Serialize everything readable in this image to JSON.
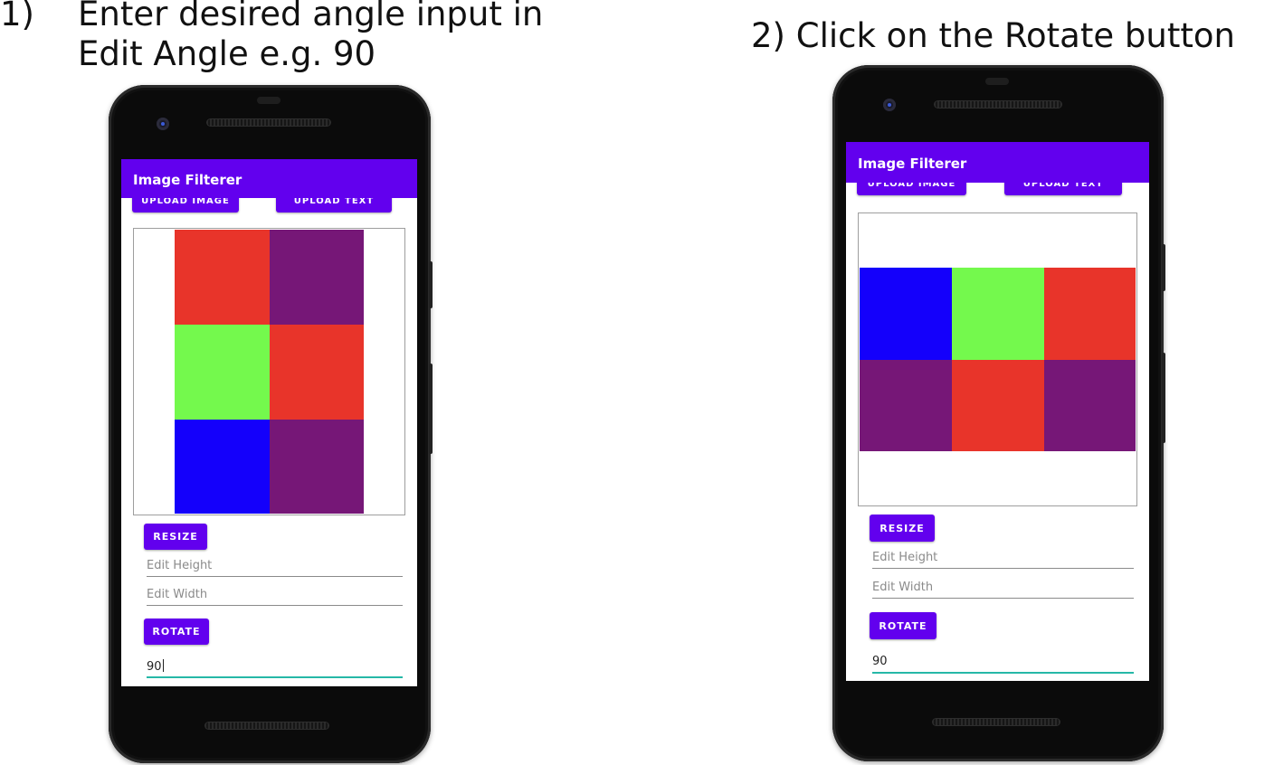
{
  "instructions": {
    "step1_number": "1)",
    "step1_line1": "Enter desired angle input  in",
    "step1_line2": "Edit Angle e.g. 90",
    "step2": "2) Click on the Rotate button"
  },
  "left_phone": {
    "app_title": "Image Filterer",
    "upload_image_label": "UPLOAD IMAGE",
    "upload_text_label": "UPLOAD TEXT",
    "resize_label": "RESIZE",
    "height_placeholder": "Edit Height",
    "width_placeholder": "Edit Width",
    "rotate_label": "ROTATE",
    "angle_value": "90",
    "image_grid_colors": [
      [
        "#e8342a",
        "#761777"
      ],
      [
        "#74f94d",
        "#e8342a"
      ],
      [
        "#1400fb",
        "#761777"
      ]
    ]
  },
  "right_phone": {
    "app_title": "Image Filterer",
    "upload_image_label": "UPLOAD IMAGE",
    "upload_text_label": "UPLOAD TEXT",
    "resize_label": "RESIZE",
    "height_placeholder": "Edit Height",
    "width_placeholder": "Edit Width",
    "rotate_label": "ROTATE",
    "angle_value": "90",
    "image_grid_colors": [
      [
        "#1400fb",
        "#74f94d",
        "#e8342a"
      ],
      [
        "#761777",
        "#e8342a",
        "#761777"
      ]
    ]
  },
  "colors": {
    "accent": "#6200ee",
    "input_focus": "#26b8a7"
  }
}
